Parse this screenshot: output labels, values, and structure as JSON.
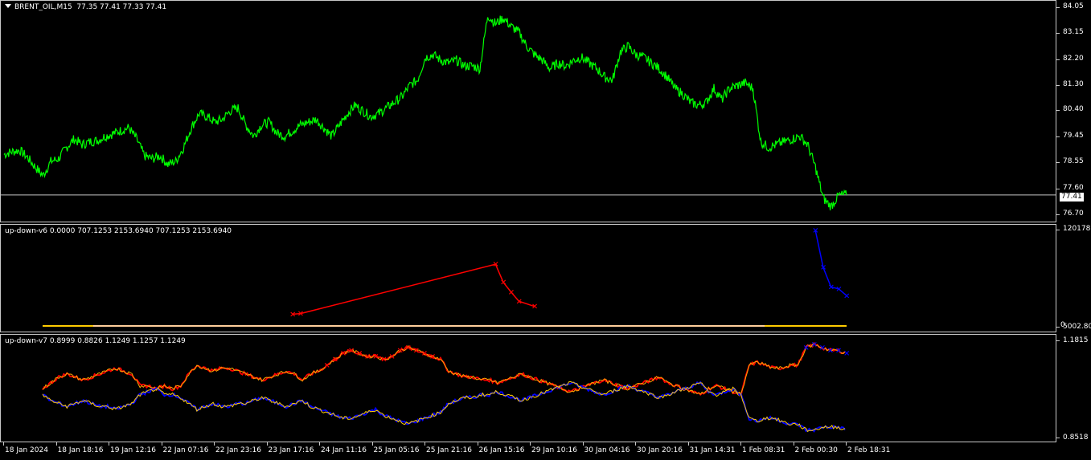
{
  "main_chart": {
    "symbol_label": "BRENT_OIL,M15",
    "ohlc_label": "77.35 77.41 77.33 77.41",
    "current_price": "77.41",
    "price_labels": [
      "84.05",
      "83.15",
      "82.20",
      "81.30",
      "80.40",
      "79.45",
      "78.55",
      "77.60",
      "76.70"
    ],
    "line_color": "#00ff00",
    "series_close": [
      78.85,
      78.95,
      79.0,
      78.75,
      78.4,
      78.1,
      78.6,
      78.7,
      79.1,
      79.4,
      79.2,
      79.3,
      79.35,
      79.5,
      79.6,
      79.7,
      79.8,
      79.4,
      78.8,
      78.7,
      78.8,
      78.5,
      78.6,
      79.1,
      79.8,
      80.3,
      80.2,
      80.0,
      80.1,
      80.4,
      80.5,
      79.9,
      79.5,
      79.9,
      80.0,
      79.6,
      79.5,
      79.7,
      79.9,
      80.0,
      80.1,
      79.8,
      79.5,
      79.9,
      80.3,
      80.6,
      80.4,
      80.2,
      80.3,
      80.5,
      80.7,
      80.9,
      81.3,
      81.5,
      82.3,
      82.4,
      82.2,
      82.1,
      82.2,
      82.0,
      82.0,
      81.9,
      83.8,
      83.5,
      83.7,
      83.4,
      83.2,
      82.7,
      82.4,
      82.2,
      81.9,
      82.1,
      82.0,
      82.2,
      82.3,
      82.1,
      81.9,
      81.6,
      81.5,
      82.5,
      82.7,
      82.4,
      82.3,
      82.1,
      81.9,
      81.6,
      81.2,
      81.0,
      80.7,
      80.6,
      80.7,
      81.2,
      80.8,
      81.2,
      81.3,
      81.4,
      81.2,
      79.3,
      79.1,
      79.2,
      79.3,
      79.4,
      79.5,
      79.2,
      78.4,
      77.3,
      77.0,
      77.4,
      77.41
    ],
    "horizontal_line_value": 77.41
  },
  "indicator_v6": {
    "title": "up-down-v6 0.0000 707.1253 2153.6940 707.1253 2153.6940",
    "axis_top_label": "120178.9",
    "axis_bottom_label": "5002.80",
    "axis_zero_label": "0",
    "up_color": "#ff0000",
    "down_color": "#0000ff",
    "baseline_color": "#ffcc00",
    "red_spikes": [
      {
        "x_index": 37,
        "value": 1800
      },
      {
        "x_index": 38,
        "value": 2000
      },
      {
        "x_index": 63,
        "value": 50000
      },
      {
        "x_index": 64,
        "value": 25000
      },
      {
        "x_index": 65,
        "value": 15000
      },
      {
        "x_index": 66,
        "value": 8000
      },
      {
        "x_index": 68,
        "value": 5000
      }
    ],
    "blue_spikes": [
      {
        "x_index": 104,
        "value": 120000
      },
      {
        "x_index": 105,
        "value": 45000
      },
      {
        "x_index": 106,
        "value": 20000
      },
      {
        "x_index": 107,
        "value": 18000
      },
      {
        "x_index": 108,
        "value": 12000
      }
    ]
  },
  "indicator_v7": {
    "title": "up-down-v7 0.8999 0.8826 1.1249 1.1257 1.1249",
    "axis_top_label": "1.1815",
    "axis_bottom_label": "0.8518",
    "upper_color_orange": "#ffa500",
    "red_marker_color": "#ff0000",
    "blue_marker_color": "#0000ff",
    "lower_color_yellow": "#ffcc00",
    "upper_series": [
      1.02,
      1.04,
      1.06,
      1.07,
      1.06,
      1.05,
      1.06,
      1.07,
      1.08,
      1.09,
      1.08,
      1.07,
      1.03,
      1.03,
      1.02,
      1.03,
      1.02,
      1.03,
      1.07,
      1.1,
      1.09,
      1.08,
      1.09,
      1.09,
      1.08,
      1.07,
      1.06,
      1.05,
      1.06,
      1.07,
      1.08,
      1.07,
      1.05,
      1.07,
      1.08,
      1.1,
      1.12,
      1.14,
      1.15,
      1.14,
      1.13,
      1.13,
      1.12,
      1.13,
      1.15,
      1.16,
      1.15,
      1.14,
      1.13,
      1.12,
      1.08,
      1.07,
      1.06,
      1.06,
      1.05,
      1.05,
      1.04,
      1.05,
      1.06,
      1.07,
      1.06,
      1.05,
      1.04,
      1.03,
      1.02,
      1.01,
      1.02,
      1.03,
      1.04,
      1.05,
      1.04,
      1.03,
      1.02,
      1.03,
      1.04,
      1.05,
      1.06,
      1.04,
      1.03,
      1.02,
      1.01,
      1.0,
      1.02,
      1.03,
      1.02,
      1.01,
      1.0,
      1.1,
      1.11,
      1.1,
      1.09,
      1.09,
      1.1,
      1.1,
      1.16,
      1.17,
      1.16,
      1.15,
      1.15,
      1.14
    ],
    "lower_series": [
      1.0,
      0.98,
      0.97,
      0.96,
      0.97,
      0.98,
      0.97,
      0.96,
      0.96,
      0.95,
      0.96,
      0.97,
      1.0,
      1.01,
      1.02,
      1.0,
      1.0,
      0.99,
      0.97,
      0.95,
      0.96,
      0.97,
      0.96,
      0.96,
      0.97,
      0.97,
      0.98,
      0.99,
      0.98,
      0.97,
      0.96,
      0.97,
      0.98,
      0.96,
      0.95,
      0.94,
      0.93,
      0.92,
      0.92,
      0.93,
      0.94,
      0.95,
      0.93,
      0.92,
      0.91,
      0.9,
      0.91,
      0.92,
      0.93,
      0.94,
      0.97,
      0.98,
      0.99,
      0.99,
      1.0,
      1.0,
      1.01,
      1.0,
      0.99,
      0.98,
      0.99,
      1.0,
      1.01,
      1.02,
      1.03,
      1.04,
      1.03,
      1.02,
      1.01,
      1.0,
      1.01,
      1.02,
      1.03,
      1.02,
      1.01,
      1.0,
      0.99,
      1.0,
      1.01,
      1.02,
      1.03,
      1.04,
      1.01,
      1.0,
      1.01,
      1.02,
      1.0,
      0.92,
      0.91,
      0.92,
      0.92,
      0.91,
      0.9,
      0.9,
      0.88,
      0.88,
      0.89,
      0.89,
      0.89,
      0.88
    ]
  },
  "time_axis": {
    "labels": [
      "18 Jan 2024",
      "18 Jan 18:16",
      "19 Jan 12:16",
      "22 Jan 07:16",
      "22 Jan 23:16",
      "23 Jan 17:16",
      "24 Jan 11:16",
      "25 Jan 05:16",
      "25 Jan 21:16",
      "26 Jan 15:16",
      "29 Jan 10:16",
      "30 Jan 04:16",
      "30 Jan 20:16",
      "31 Jan 14:31",
      "1 Feb 08:31",
      "2 Feb 00:30",
      "2 Feb 18:31"
    ]
  }
}
